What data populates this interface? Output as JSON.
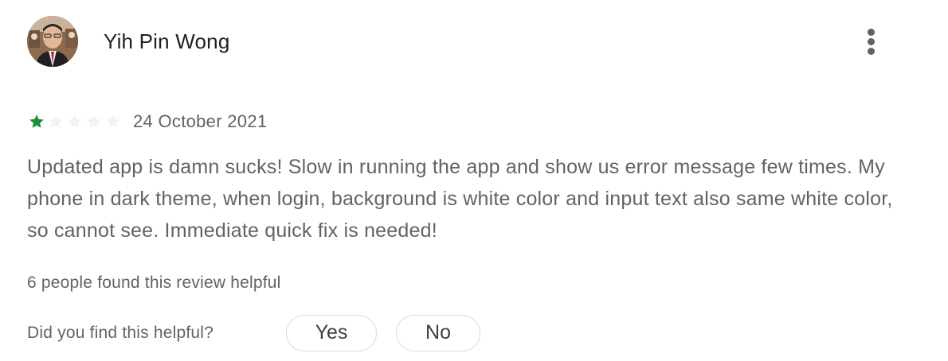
{
  "review": {
    "reviewer_name": "Yih Pin Wong",
    "avatar_icon": "reviewer-avatar-photo",
    "more_icon": "more-vert-icon",
    "rating": 1,
    "rating_max": 5,
    "star_filled_color": "#1e8e3e",
    "star_empty_color": "#f1f3f4",
    "date": "24 October 2021",
    "text": "Updated app is damn sucks! Slow in running the app and show us error message few times. My phone in dark theme, when login, background is white color and input text also same white color, so cannot see. Immediate quick fix is needed!",
    "helpful_count_text": "6 people found this review helpful"
  },
  "feedback": {
    "question": "Did you find this helpful?",
    "yes_label": "Yes",
    "no_label": "No"
  }
}
